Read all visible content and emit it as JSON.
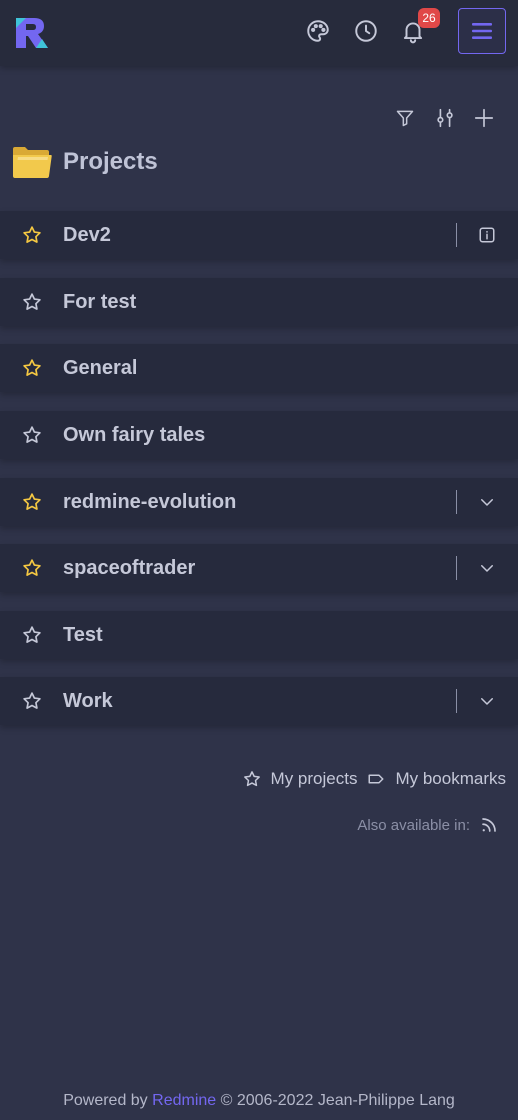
{
  "header": {
    "notifications_count": "26",
    "icons": [
      "logo",
      "palette-icon",
      "clock-icon",
      "bell-icon",
      "hamburger-menu-icon"
    ]
  },
  "toolbar": {
    "icons": [
      "filter-icon",
      "sliders-icon",
      "plus-icon"
    ]
  },
  "page": {
    "title": "Projects"
  },
  "projects": [
    {
      "name": "Dev2",
      "starred": true,
      "action": "info-icon"
    },
    {
      "name": "For test",
      "starred": false,
      "action": ""
    },
    {
      "name": "General",
      "starred": true,
      "action": ""
    },
    {
      "name": "Own fairy tales",
      "starred": false,
      "action": ""
    },
    {
      "name": "redmine-evolution",
      "starred": true,
      "action": "chevron-down-icon"
    },
    {
      "name": "spaceoftrader",
      "starred": true,
      "action": "chevron-down-icon"
    },
    {
      "name": "Test",
      "starred": false,
      "action": ""
    },
    {
      "name": "Work",
      "starred": false,
      "action": "chevron-down-icon"
    }
  ],
  "links": {
    "my_projects": "My projects",
    "my_bookmarks": "My bookmarks"
  },
  "also_available": "Also available in:",
  "footer": {
    "prefix": "Powered by",
    "link": "Redmine",
    "suffix": "© 2006-2022 Jean-Philippe Lang"
  },
  "colors": {
    "accent": "#7367f0",
    "star_active": "#f5c842",
    "badge": "#e04848",
    "background": "#2f3349",
    "row": "#262a3d"
  }
}
